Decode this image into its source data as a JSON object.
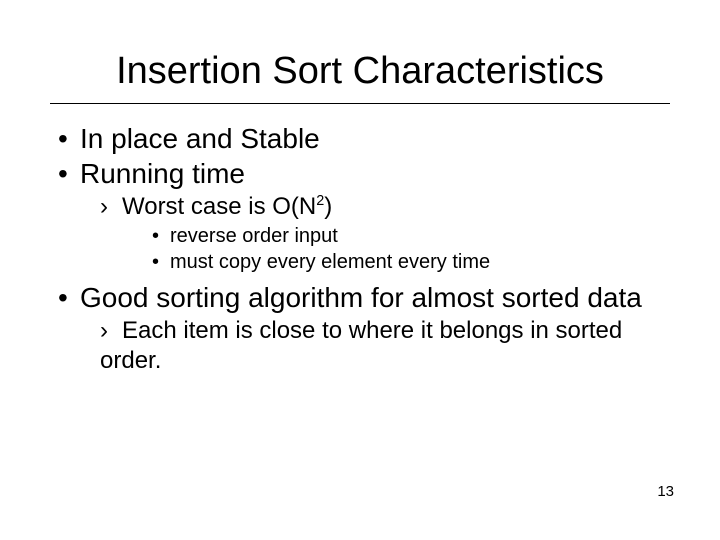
{
  "title": "Insertion Sort Characteristics",
  "b1": "In place and Stable",
  "b2": "Running time",
  "b2a_pre": "Worst case is O(N",
  "b2a_sup": "2",
  "b2a_post": ")",
  "b2a1": "reverse order input",
  "b2a2": "must copy every element every time",
  "b3": "Good sorting algorithm for almost sorted data",
  "b3a": "Each item is close to where it belongs in sorted order.",
  "page": "13"
}
